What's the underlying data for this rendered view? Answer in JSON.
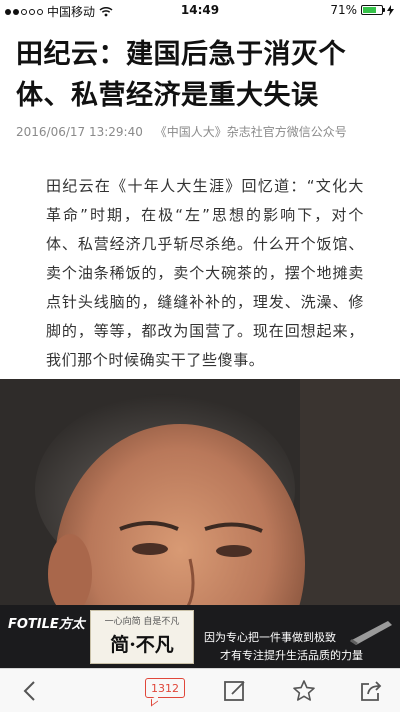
{
  "status_bar": {
    "carrier": "中国移动",
    "time": "14:49",
    "battery": "71%",
    "battery_level": 0.71
  },
  "article": {
    "title": "田纪云：建国后急于消灭个体、私营经济是重大失误",
    "date": "2016/06/17 13:29:40",
    "source": "《中国人大》杂志社官方微信公众号",
    "body": "田纪云在《十年人大生涯》回忆道：“文化大革命”时期，在极“左”思想的影响下，对个体、私营经济几乎斩尽杀绝。什么开个饭馆、卖个油条稀饭的，卖个大碗茶的，摆个地摊卖点针头线脑的，缝缝补补的，理发、洗澡、修脚的，等等，都改为国营了。现在回想起来，我们那个时候确实干了些傻事。"
  },
  "ad": {
    "brand": "FOTILE方太",
    "tagline_small": "一心向简 自是不凡",
    "tagline_main": "简·不凡",
    "line1": "因为专心把一件事做到极致",
    "line2": "才有专注提升生活品质的力量"
  },
  "toolbar": {
    "comment_count": "1312",
    "icons": [
      "back-arrow-icon",
      "comment-icon",
      "edit-icon",
      "star-icon",
      "share-icon"
    ]
  },
  "colors": {
    "accent": "#e0473a",
    "battery_green": "#36c24a",
    "meta_gray": "#8a8a8a"
  }
}
